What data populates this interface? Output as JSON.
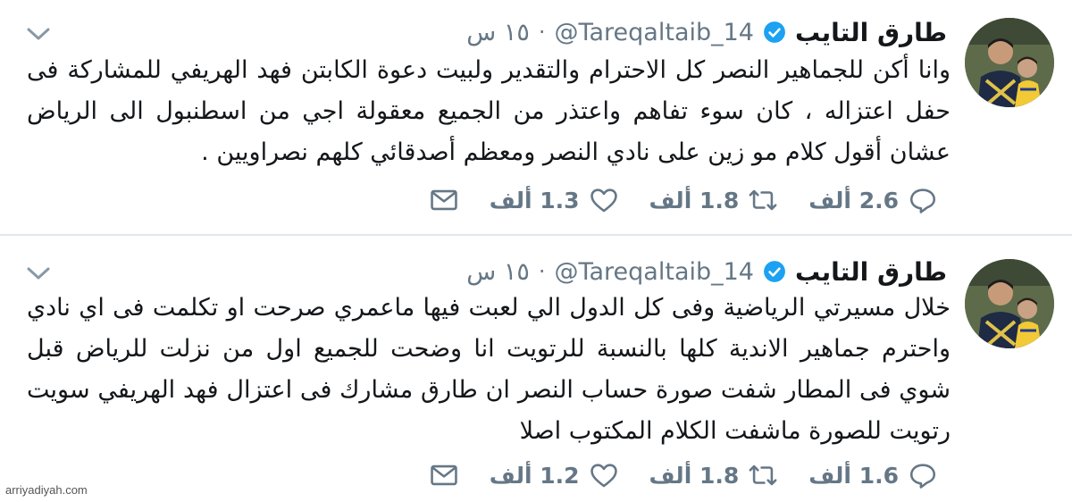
{
  "tweets": [
    {
      "author_name": "طارق التايب",
      "handle": "@Tareqaltaib_14",
      "separator": "·",
      "time": "١٥ س",
      "text": "وانا أكن للجماهير النصر كل الاحترام والتقدير ولبيت دعوة الكابتن فهد الهريفي للمشاركة فى حفل اعتزاله ، كان سوء تفاهم واعتذر من الجميع معقولة اجي من اسطنبول الى الرياض عشان أقول كلام مو زين على نادي النصر ومعظم أصدقائي كلهم نصراويين .",
      "replies": "2.6 ألف",
      "retweets": "1.8 ألف",
      "likes": "1.3 ألف"
    },
    {
      "author_name": "طارق التايب",
      "handle": "@Tareqaltaib_14",
      "separator": "·",
      "time": "١٥ س",
      "text": "خلال مسيرتي الرياضية وفى كل الدول الي لعبت فيها ماعمري صرحت او تكلمت فى اي نادي واحترم جماهير الاندية كلها بالنسبة للرتويت انا وضحت للجميع اول من نزلت للرياض قبل شوي فى المطار شفت صورة حساب النصر ان طارق مشارك فى اعتزال فهد الهريفي سويت رتويت للصورة ماشفت الكلام المكتوب اصلا",
      "replies": "1.6 ألف",
      "retweets": "1.8 ألف",
      "likes": "1.2 ألف"
    }
  ],
  "icons": {
    "verified": "verified-badge-icon",
    "caret": "chevron-down-icon",
    "reply": "reply-icon",
    "retweet": "retweet-icon",
    "like": "heart-icon",
    "dm": "envelope-icon"
  },
  "colors": {
    "verified": "#1da1f2",
    "secondary_text": "#657786",
    "divider": "#e1e8ed"
  },
  "watermark": "arriyadiyah.com"
}
